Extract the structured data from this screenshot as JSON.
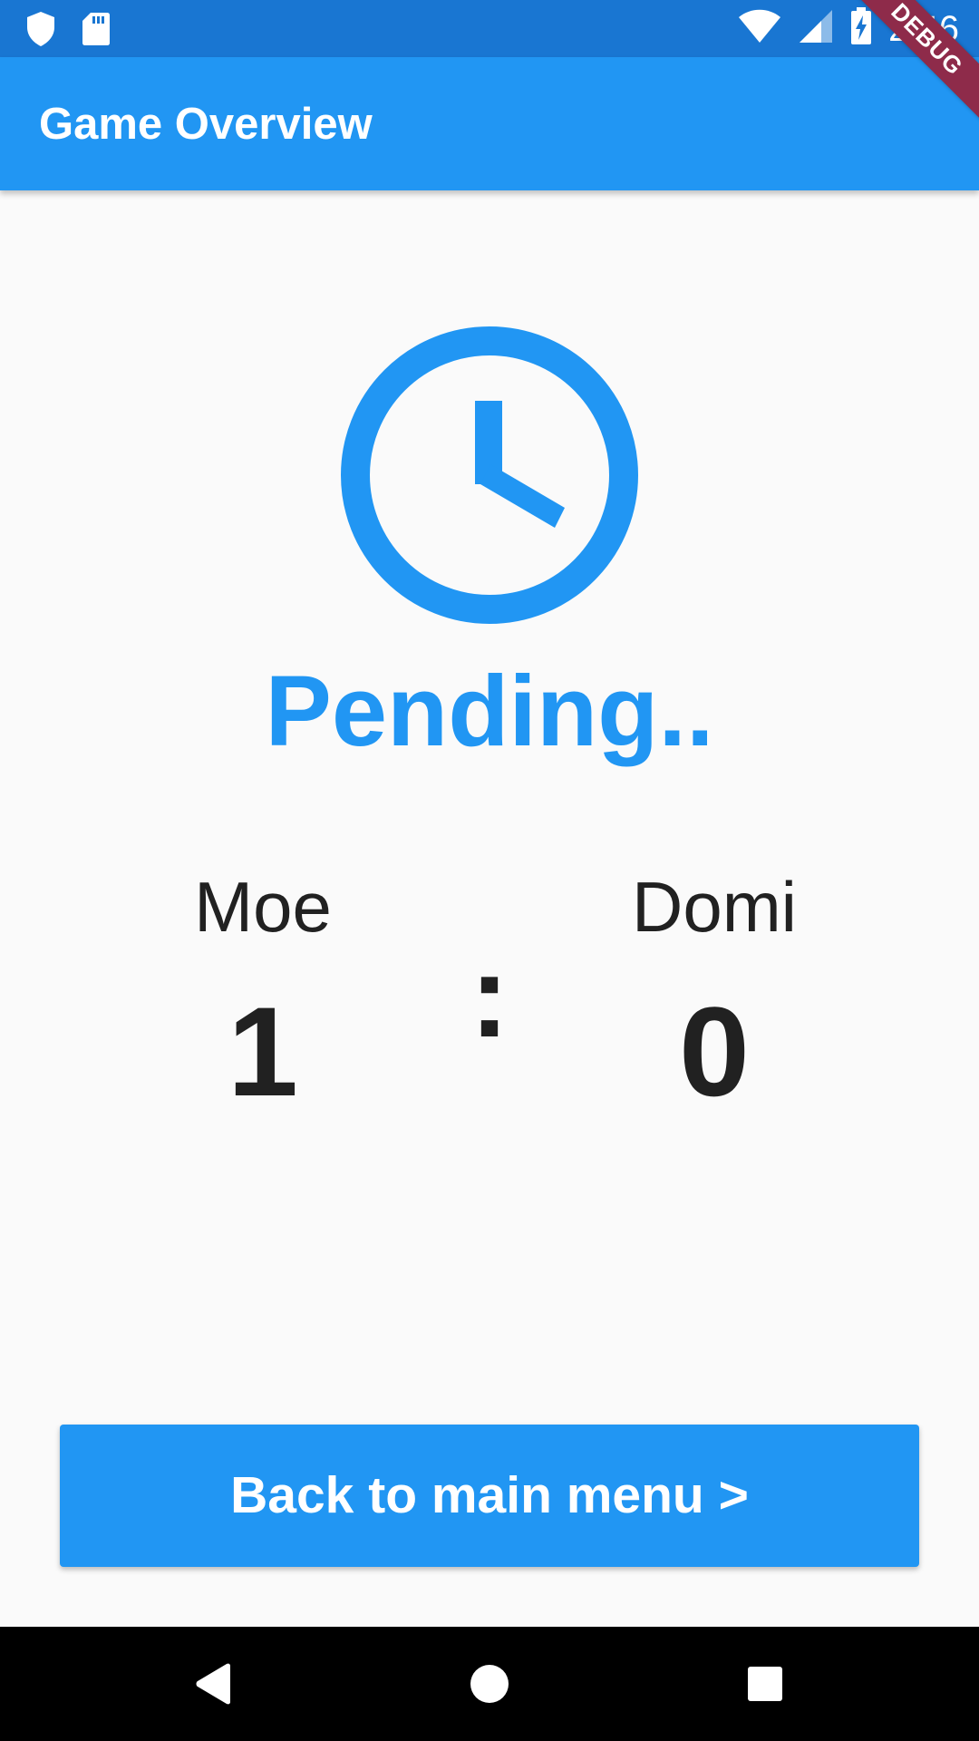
{
  "status_bar": {
    "time": "2:46",
    "left_icons": [
      "shield-icon",
      "sd-card-icon"
    ],
    "right_icons": [
      "wifi-icon",
      "cell-signal-icon",
      "battery-charging-icon"
    ],
    "background": "#1976d2"
  },
  "debug_banner": {
    "label": "DEBUG",
    "color": "#8e2b4a"
  },
  "app_bar": {
    "title": "Game Overview",
    "background": "#2196f3"
  },
  "game": {
    "status_icon": "clock-icon",
    "status_label": "Pending..",
    "accent_color": "#2196f3",
    "player1": {
      "name": "Moe",
      "score": "1"
    },
    "separator": ":",
    "player2": {
      "name": "Domi",
      "score": "0"
    }
  },
  "actions": {
    "back_label": "Back to main menu >"
  },
  "nav_bar": {
    "icons": [
      "back-triangle-icon",
      "home-circle-icon",
      "recents-square-icon"
    ]
  }
}
